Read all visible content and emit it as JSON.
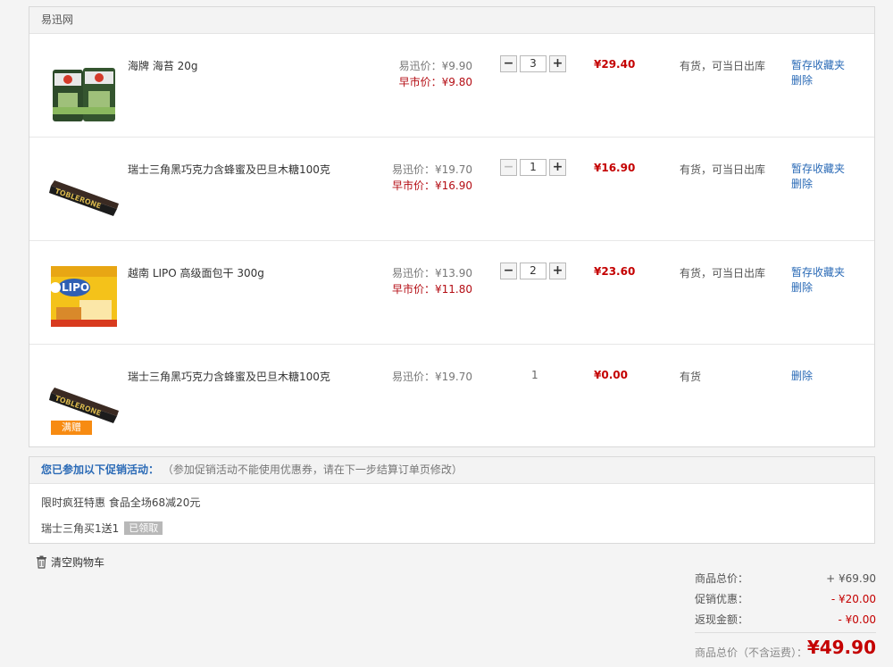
{
  "store": {
    "name": "易迅网"
  },
  "items": [
    {
      "name": "海牌 海苔 20g",
      "price_label": "易迅价：",
      "price": "¥9.90",
      "early_label": "早市价：",
      "early_price": "¥9.80",
      "quantity": "3",
      "subtotal": "¥29.40",
      "stock": "有货，可当日出库",
      "save_label": "暂存收藏夹",
      "delete_label": "删除"
    },
    {
      "name": "瑞士三角黑巧克力含蜂蜜及巴旦木糖100克",
      "price_label": "易迅价：",
      "price": "¥19.70",
      "early_label": "早市价：",
      "early_price": "¥16.90",
      "quantity": "1",
      "subtotal": "¥16.90",
      "stock": "有货，可当日出库",
      "save_label": "暂存收藏夹",
      "delete_label": "删除"
    },
    {
      "name": "越南 LIPO 高级面包干 300g",
      "price_label": "易迅价：",
      "price": "¥13.90",
      "early_label": "早市价：",
      "early_price": "¥11.80",
      "quantity": "2",
      "subtotal": "¥23.60",
      "stock": "有货，可当日出库",
      "save_label": "暂存收藏夹",
      "delete_label": "删除"
    },
    {
      "name": "瑞士三角黑巧克力含蜂蜜及巴旦木糖100克",
      "price_label": "易迅价：",
      "price": "¥19.70",
      "quantity": "1",
      "subtotal": "¥0.00",
      "stock": "有货",
      "delete_label": "删除",
      "gift_tag": "满赠"
    }
  ],
  "thumb_text": {
    "toblerone": "TOBLERONE",
    "lipo": "LIPO"
  },
  "qty_controls": {
    "minus": "−",
    "plus": "+"
  },
  "promo": {
    "title": "您已参加以下促销活动：",
    "note": "（参加促销活动不能使用优惠券，请在下一步结算订单页修改）",
    "line1": "限时疯狂特惠 食品全场68减20元",
    "line2": "瑞士三角买1送1",
    "badge": "已领取"
  },
  "clear_cart": "清空购物车",
  "summary": {
    "goods_total_label": "商品总价：",
    "goods_total": "+ ¥69.90",
    "promo_discount_label": "促销优惠：",
    "promo_discount": "- ¥20.00",
    "cashback_label": "返现金额：",
    "cashback": "- ¥0.00",
    "total_label": "商品总价（不含运费）：",
    "total": "¥49.90"
  },
  "colors": {
    "price_red": "#c40000",
    "link_blue": "#2a6ab6",
    "gift_orange": "#f78b12"
  }
}
